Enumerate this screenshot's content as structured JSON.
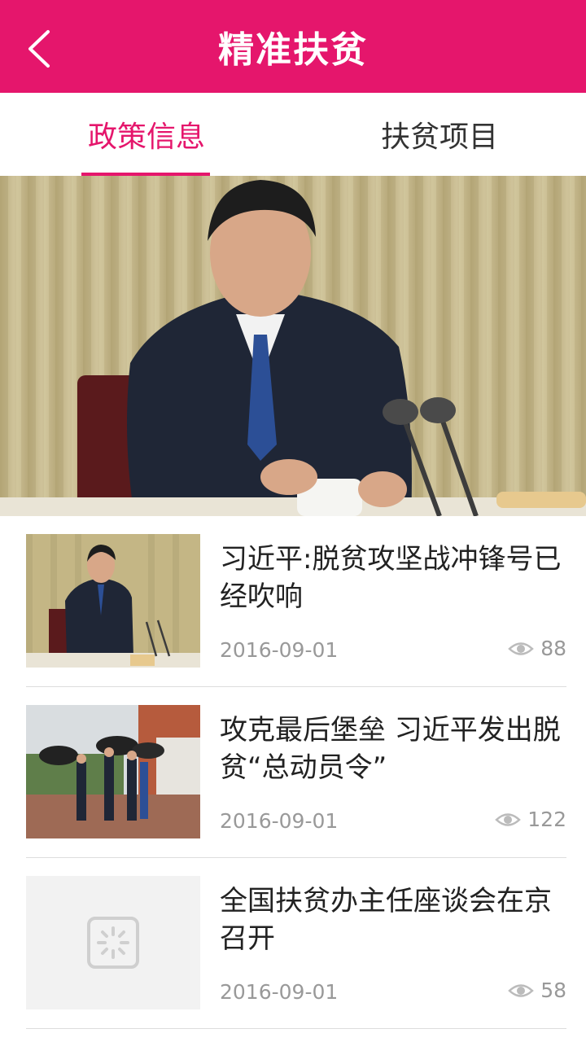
{
  "colors": {
    "brand": "#E5166C"
  },
  "header": {
    "title": "精准扶贫",
    "back_icon": "chevron-left-icon"
  },
  "tabs": [
    {
      "label": "政策信息",
      "active": true
    },
    {
      "label": "扶贫项目",
      "active": false
    }
  ],
  "carousel": {
    "total_slides": 3,
    "active_index": 0
  },
  "news": [
    {
      "title": "习近平:脱贫攻坚战冲锋号已经吹响",
      "date": "2016-09-01",
      "views": "88"
    },
    {
      "title": "攻克最后堡垒 习近平发出脱贫“总动员令”",
      "date": "2016-09-01",
      "views": "122"
    },
    {
      "title": "全国扶贫办主任座谈会在京召开",
      "date": "2016-09-01",
      "views": "58"
    }
  ]
}
